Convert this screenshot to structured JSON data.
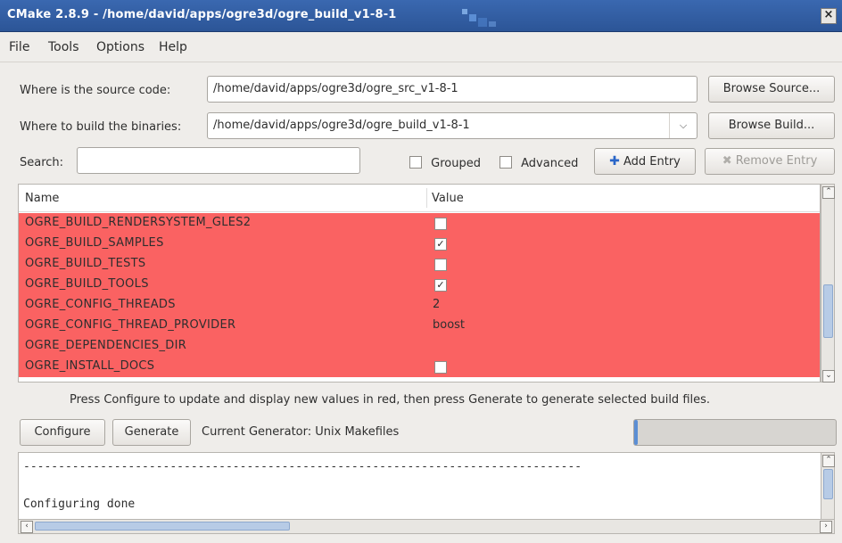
{
  "window": {
    "title": "CMake 2.8.9 - /home/david/apps/ogre3d/ogre_build_v1-8-1",
    "close": "×"
  },
  "menu": [
    {
      "label": "File"
    },
    {
      "label": "Tools"
    },
    {
      "label": "Options"
    },
    {
      "label": "Help"
    }
  ],
  "source": {
    "label": "Where is the source code:",
    "value": "/home/david/apps/ogre3d/ogre_src_v1-8-1",
    "button": "Browse Source..."
  },
  "build": {
    "label": "Where to build the binaries:",
    "value": "/home/david/apps/ogre3d/ogre_build_v1-8-1",
    "button": "Browse Build..."
  },
  "search": {
    "label": "Search:",
    "value": ""
  },
  "options": {
    "grouped": "Grouped",
    "advanced": "Advanced",
    "add_entry": "Add Entry",
    "remove_entry": "Remove Entry"
  },
  "table": {
    "col_name": "Name",
    "col_value": "Value",
    "rows": [
      {
        "name": "OGRE_BUILD_RENDERSYSTEM_GLES2",
        "value": "",
        "checked": false
      },
      {
        "name": "OGRE_BUILD_SAMPLES",
        "value": "",
        "checked": true
      },
      {
        "name": "OGRE_BUILD_TESTS",
        "value": "",
        "checked": false
      },
      {
        "name": "OGRE_BUILD_TOOLS",
        "value": "",
        "checked": true
      },
      {
        "name": "OGRE_CONFIG_THREADS",
        "value": "2"
      },
      {
        "name": "OGRE_CONFIG_THREAD_PROVIDER",
        "value": "boost"
      },
      {
        "name": "OGRE_DEPENDENCIES_DIR",
        "value": ""
      },
      {
        "name": "OGRE_INSTALL_DOCS",
        "value": "",
        "checked": false
      }
    ]
  },
  "hint": "Press Configure to update and display new values in red, then press Generate to generate selected build files.",
  "actions": {
    "configure": "Configure",
    "generate": "Generate",
    "generator": "Current Generator: Unix Makefiles"
  },
  "log": {
    "line1": "--------------------------------------------------------------------------------",
    "line2": "Configuring done"
  },
  "colors": {
    "changed_row": "#fa6262",
    "titlebar": "#3a68b0"
  }
}
